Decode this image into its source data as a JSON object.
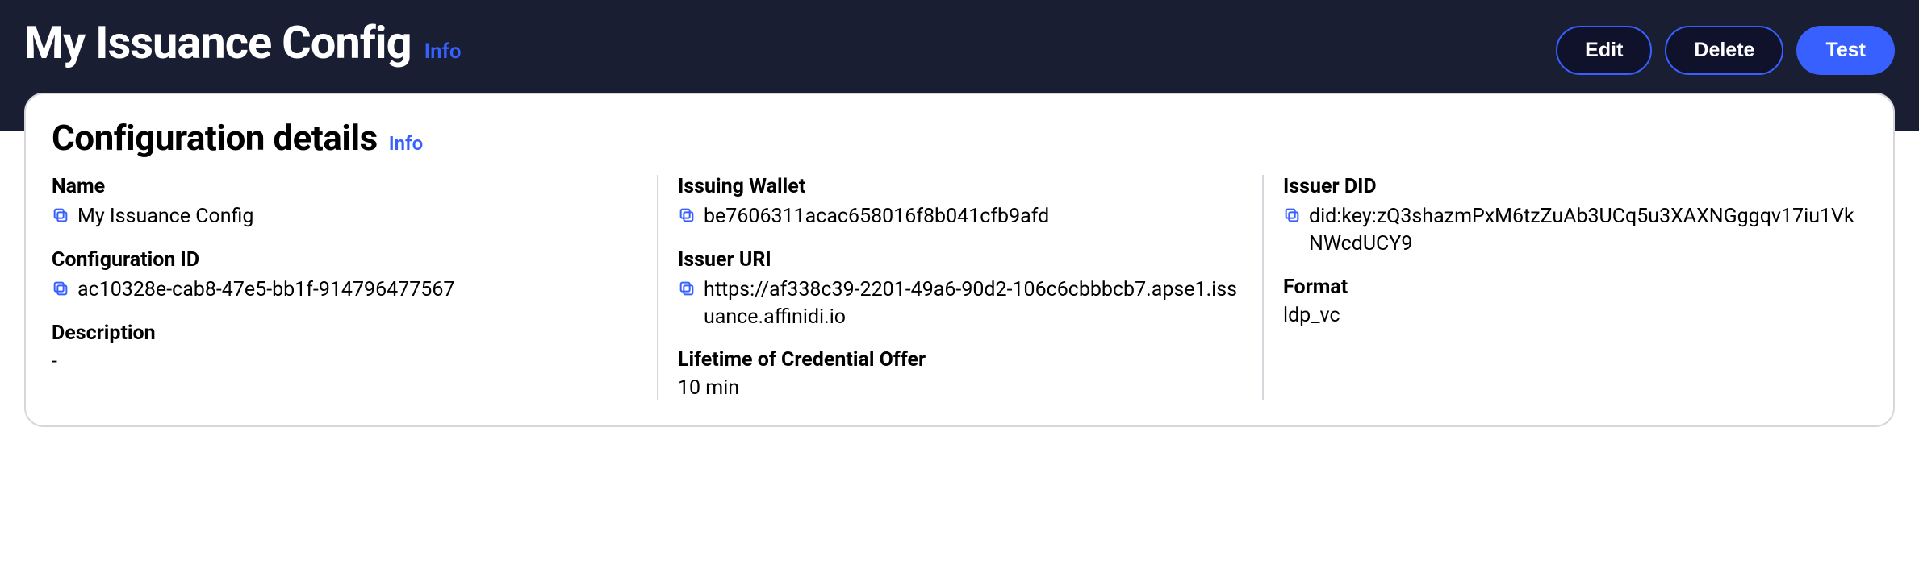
{
  "header": {
    "title": "My Issuance Config",
    "info_label": "Info",
    "actions": {
      "edit": "Edit",
      "delete": "Delete",
      "test": "Test"
    }
  },
  "card": {
    "title": "Configuration details",
    "info_label": "Info",
    "col1": {
      "name": {
        "label": "Name",
        "value": "My Issuance Config"
      },
      "config_id": {
        "label": "Configuration ID",
        "value": "ac10328e-cab8-47e5-bb1f-914796477567"
      },
      "description": {
        "label": "Description",
        "value": "-"
      }
    },
    "col2": {
      "issuing_wallet": {
        "label": "Issuing Wallet",
        "value": "be7606311acac658016f8b041cfb9afd"
      },
      "issuer_uri": {
        "label": "Issuer URI",
        "value": "https://af338c39-2201-49a6-90d2-106c6cbbbcb7.apse1.issuance.affinidi.io"
      },
      "lifetime": {
        "label": "Lifetime of Credential Offer",
        "value": "10 min"
      }
    },
    "col3": {
      "issuer_did": {
        "label": "Issuer DID",
        "value": "did:key:zQ3shazmPxM6tzZuAb3UCq5u3XAXNGggqv17iu1VkNWcdUCY9"
      },
      "format": {
        "label": "Format",
        "value": "ldp_vc"
      }
    }
  }
}
